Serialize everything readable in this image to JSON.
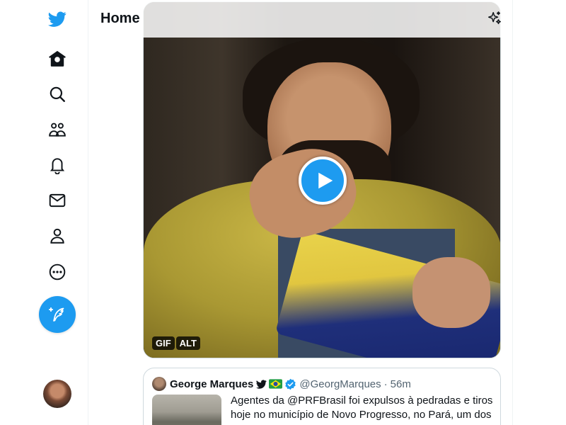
{
  "header": {
    "title": "Home"
  },
  "sidebar": {
    "items": [
      {
        "icon": "twitter-bird-icon"
      },
      {
        "icon": "home-icon"
      },
      {
        "icon": "search-icon"
      },
      {
        "icon": "communities-icon"
      },
      {
        "icon": "notifications-bell-icon"
      },
      {
        "icon": "messages-envelope-icon"
      },
      {
        "icon": "profile-icon"
      },
      {
        "icon": "more-circle-icon"
      }
    ],
    "compose_icon": "compose-tweet-icon"
  },
  "media": {
    "gif_label": "GIF",
    "alt_label": "ALT",
    "play_icon": "play-icon"
  },
  "quoted_tweet": {
    "name": "George Marques",
    "handle": "@GeorgMarques",
    "separator": "·",
    "time": "56m",
    "text": "Agentes da @PRFBrasil foi expulsos à pedradas e tiros hoje no município de Novo Progresso, no Pará, um dos"
  },
  "colors": {
    "accent": "#1d9bf0",
    "text": "#0f1419",
    "muted": "#536471",
    "border": "#cfd9de"
  }
}
